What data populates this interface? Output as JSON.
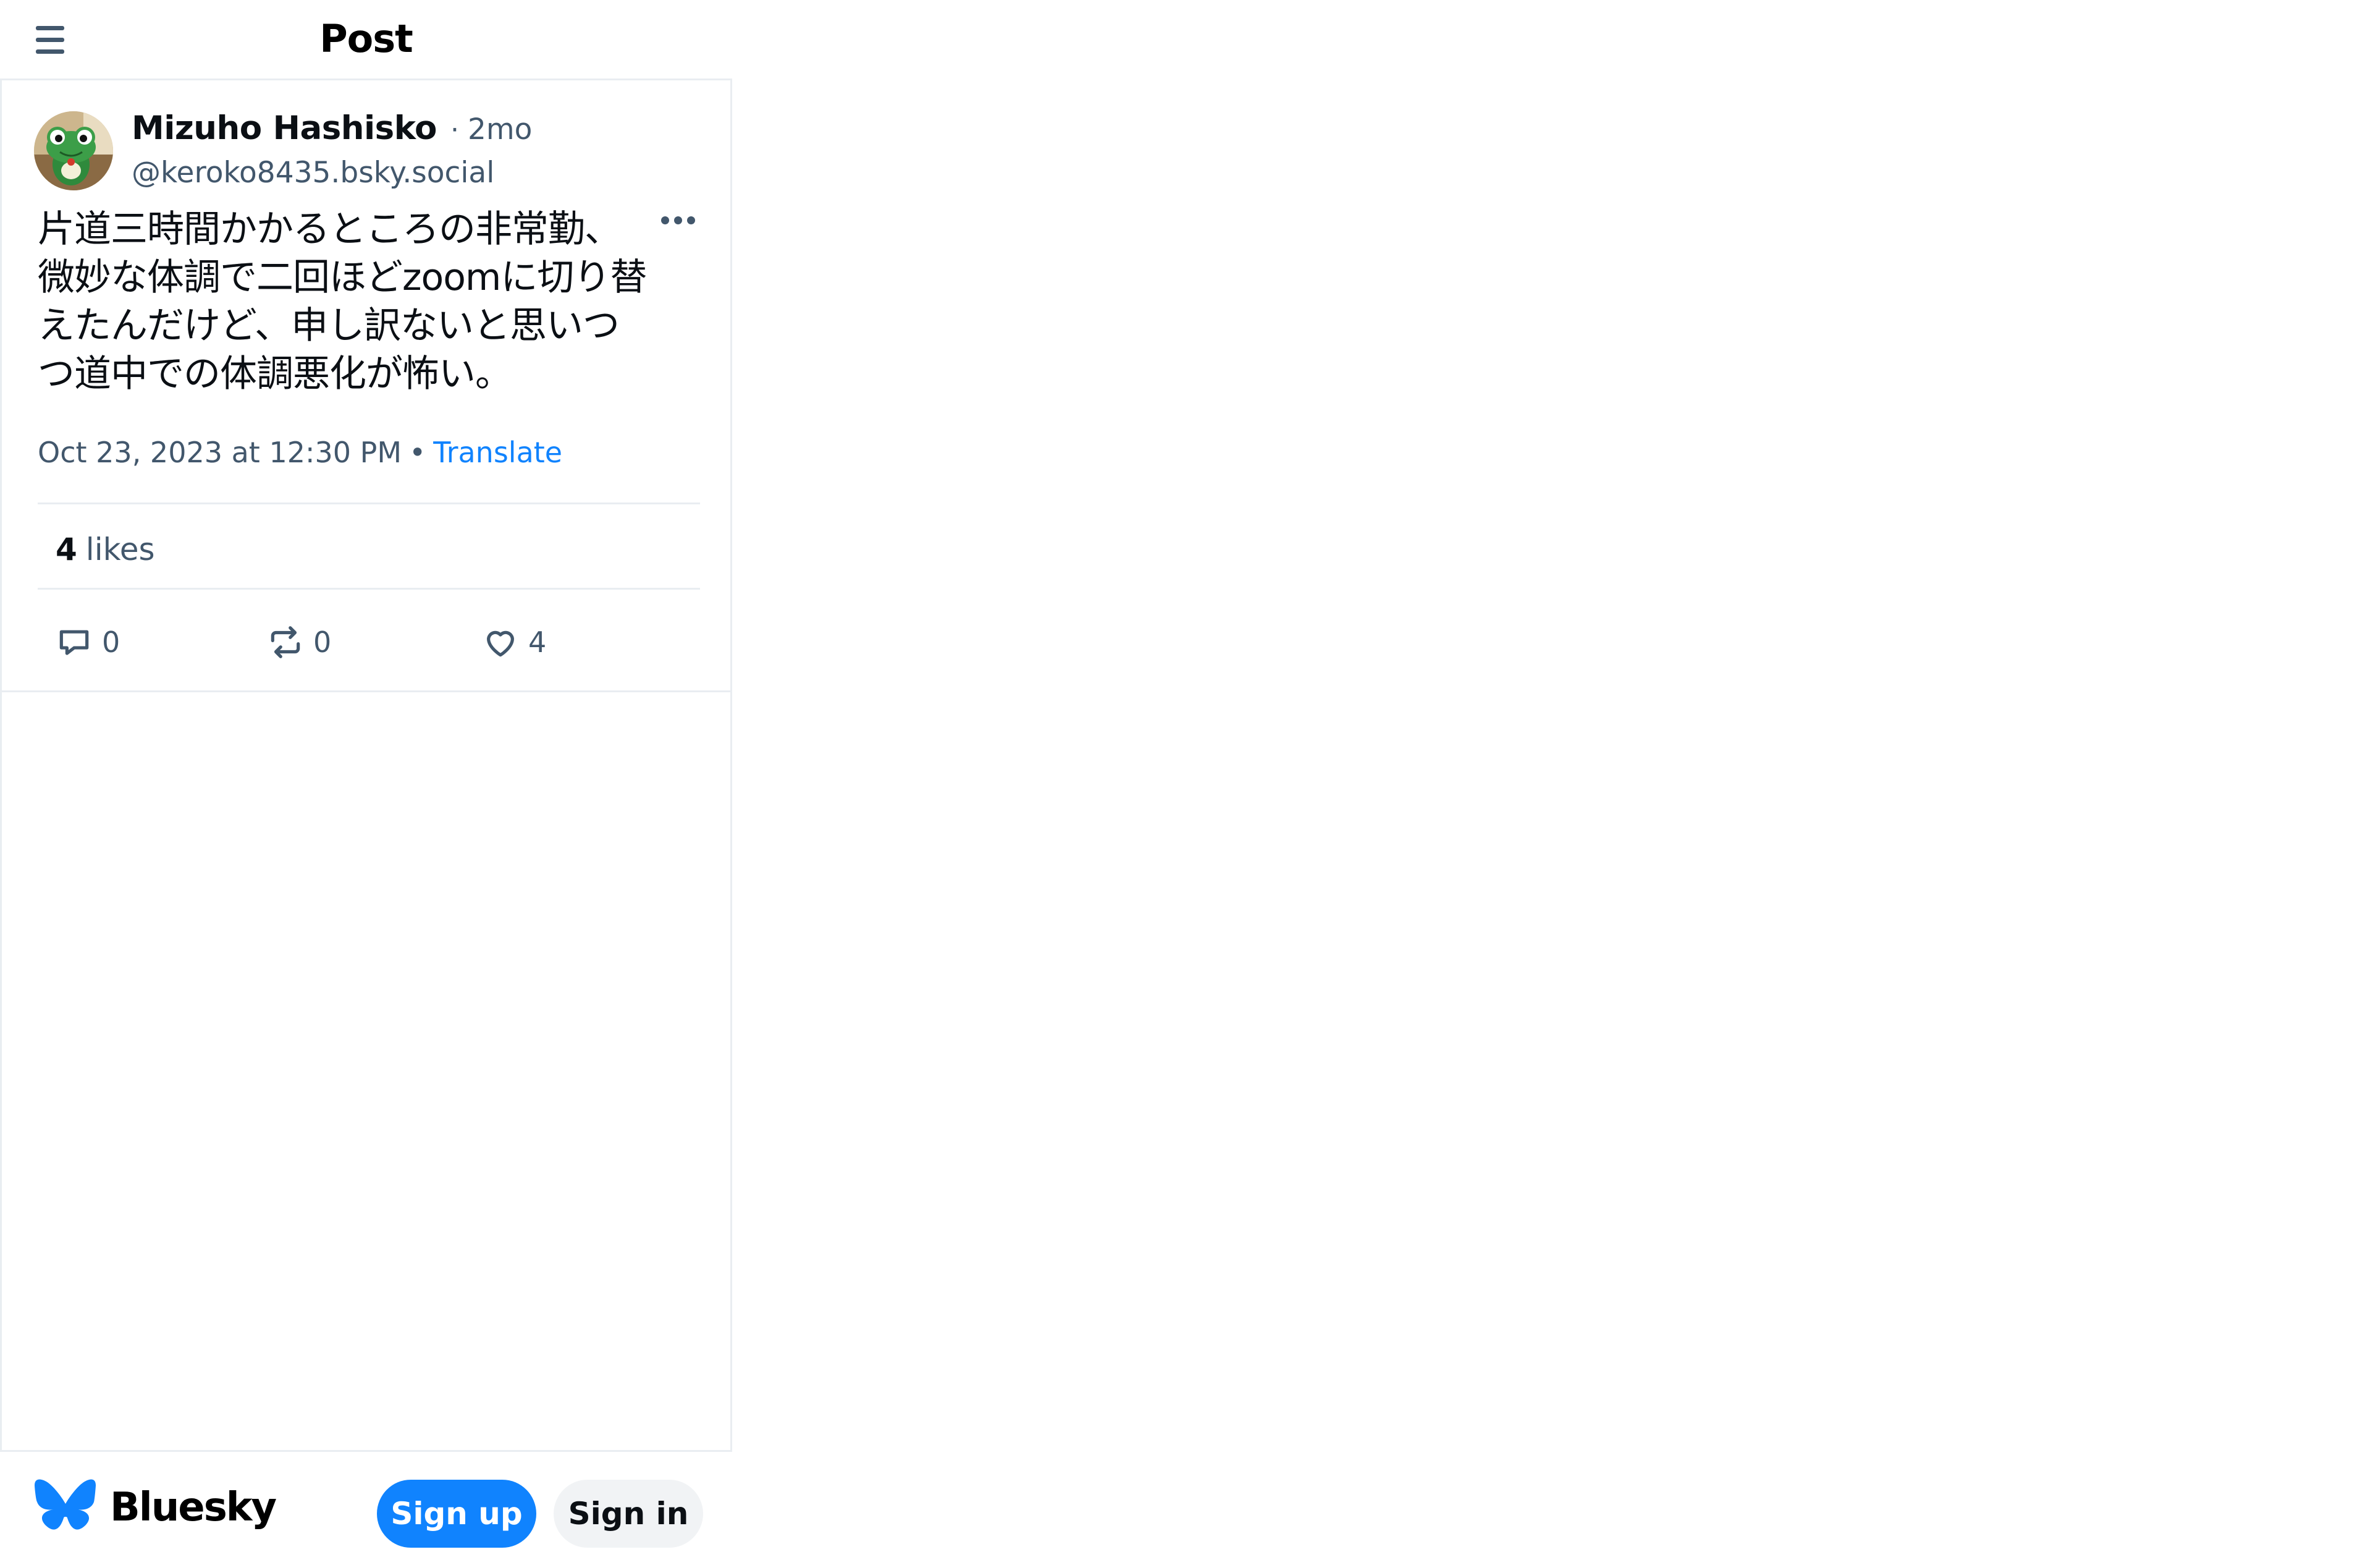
{
  "header": {
    "title": "Post",
    "menu_icon": "hamburger-menu-icon"
  },
  "post": {
    "author": {
      "display_name": "Mizuho Hashisko",
      "separator": "·",
      "age": "2mo",
      "handle": "@keroko8435.bsky.social",
      "avatar_icon": "frog-avatar"
    },
    "text": "片道三時間かかるところの非常勤、\n微妙な体調で二回ほどzoomに切り替\nえたんだけど、申し訳ないと思いつ\nつ道中での体調悪化が怖い。",
    "timestamp": "Oct 23, 2023 at 12:30 PM",
    "bullet": "•",
    "translate_label": "Translate",
    "likes_count": "4",
    "likes_label": "likes",
    "actions": {
      "reply_count": "0",
      "repost_count": "0",
      "like_count": "4"
    }
  },
  "footer": {
    "brand": "Bluesky",
    "signup_label": "Sign up",
    "signin_label": "Sign in"
  },
  "colors": {
    "accent": "#1083fe",
    "muted_text": "#42576c",
    "border": "#e9edf1"
  }
}
